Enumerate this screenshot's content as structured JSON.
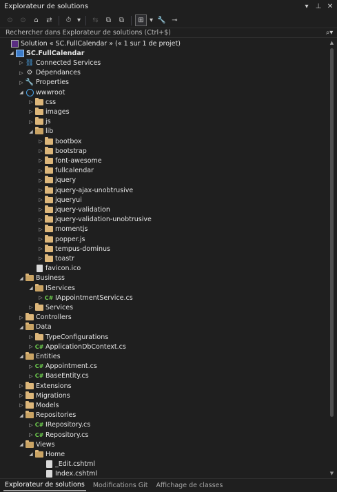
{
  "window": {
    "title": "Explorateur de solutions",
    "controls": [
      "▾",
      "⊥",
      "✕"
    ]
  },
  "toolbar": {
    "items": [
      {
        "icon": "back-arrow-icon",
        "glyph": "⊙",
        "enabled": false
      },
      {
        "icon": "forward-arrow-icon",
        "glyph": "⊙",
        "enabled": false
      },
      {
        "icon": "home-icon",
        "glyph": "⌂",
        "enabled": true
      },
      {
        "icon": "switch-views-icon",
        "glyph": "⇄",
        "enabled": true
      },
      {
        "icon": "pending-changes-filter-icon",
        "glyph": "⏱",
        "enabled": true
      },
      {
        "icon": "dropdown-icon",
        "glyph": "▾",
        "enabled": true
      },
      {
        "icon": "sync-icon",
        "glyph": "⇆",
        "enabled": false
      },
      {
        "icon": "collapse-all-icon",
        "glyph": "⧉",
        "enabled": true
      },
      {
        "icon": "show-all-files-icon",
        "glyph": "⧉",
        "enabled": true
      },
      {
        "icon": "tree-view-icon",
        "glyph": "⊞",
        "enabled": true,
        "active": true
      },
      {
        "icon": "dropdown-icon",
        "glyph": "▾",
        "enabled": true
      },
      {
        "icon": "properties-wrench-icon",
        "glyph": "🔧",
        "enabled": true
      },
      {
        "icon": "preview-icon",
        "glyph": "⊸",
        "enabled": true
      }
    ]
  },
  "search": {
    "placeholder": "Rechercher dans Explorateur de solutions (Ctrl+$)",
    "icon": "search-icon"
  },
  "tree": [
    {
      "level": 0,
      "arrow": "",
      "icon": "sol",
      "label": "Solution « SC.FullCalendar » (« 1 sur 1 de projet)"
    },
    {
      "level": 0,
      "arrow": "open",
      "icon": "proj",
      "label": "SC.FullCalendar",
      "bold": true
    },
    {
      "level": 1,
      "arrow": "closed",
      "icon": "conn",
      "label": "Connected Services"
    },
    {
      "level": 1,
      "arrow": "closed",
      "icon": "deps",
      "label": "Dépendances"
    },
    {
      "level": 1,
      "arrow": "closed",
      "icon": "props",
      "label": "Properties"
    },
    {
      "level": 1,
      "arrow": "open",
      "icon": "globe",
      "label": "wwwroot"
    },
    {
      "level": 2,
      "arrow": "closed",
      "icon": "folder",
      "label": "css"
    },
    {
      "level": 2,
      "arrow": "closed",
      "icon": "folder",
      "label": "images"
    },
    {
      "level": 2,
      "arrow": "closed",
      "icon": "folder",
      "label": "js"
    },
    {
      "level": 2,
      "arrow": "open",
      "icon": "folder-open",
      "label": "lib"
    },
    {
      "level": 3,
      "arrow": "closed",
      "icon": "folder",
      "label": "bootbox"
    },
    {
      "level": 3,
      "arrow": "closed",
      "icon": "folder",
      "label": "bootstrap"
    },
    {
      "level": 3,
      "arrow": "closed",
      "icon": "folder",
      "label": "font-awesome"
    },
    {
      "level": 3,
      "arrow": "closed",
      "icon": "folder",
      "label": "fullcalendar"
    },
    {
      "level": 3,
      "arrow": "closed",
      "icon": "folder",
      "label": "jquery"
    },
    {
      "level": 3,
      "arrow": "closed",
      "icon": "folder",
      "label": "jquery-ajax-unobtrusive"
    },
    {
      "level": 3,
      "arrow": "closed",
      "icon": "folder",
      "label": "jqueryui"
    },
    {
      "level": 3,
      "arrow": "closed",
      "icon": "folder",
      "label": "jquery-validation"
    },
    {
      "level": 3,
      "arrow": "closed",
      "icon": "folder",
      "label": "jquery-validation-unobtrusive"
    },
    {
      "level": 3,
      "arrow": "closed",
      "icon": "folder",
      "label": "momentjs"
    },
    {
      "level": 3,
      "arrow": "closed",
      "icon": "folder",
      "label": "popper.js"
    },
    {
      "level": 3,
      "arrow": "closed",
      "icon": "folder",
      "label": "tempus-dominus"
    },
    {
      "level": 3,
      "arrow": "closed",
      "icon": "folder",
      "label": "toastr"
    },
    {
      "level": 2,
      "arrow": "",
      "icon": "file",
      "label": "favicon.ico"
    },
    {
      "level": 1,
      "arrow": "open",
      "icon": "folder-open",
      "label": "Business"
    },
    {
      "level": 2,
      "arrow": "open",
      "icon": "folder-open",
      "label": "IServices"
    },
    {
      "level": 3,
      "arrow": "closed",
      "icon": "cs",
      "label": "IAppointmentService.cs"
    },
    {
      "level": 2,
      "arrow": "closed",
      "icon": "folder",
      "label": "Services"
    },
    {
      "level": 1,
      "arrow": "closed",
      "icon": "folder",
      "label": "Controllers"
    },
    {
      "level": 1,
      "arrow": "open",
      "icon": "folder-open",
      "label": "Data"
    },
    {
      "level": 2,
      "arrow": "closed",
      "icon": "folder",
      "label": "TypeConfigurations"
    },
    {
      "level": 2,
      "arrow": "closed",
      "icon": "cs",
      "label": "ApplicationDbContext.cs"
    },
    {
      "level": 1,
      "arrow": "open",
      "icon": "folder-open",
      "label": "Entities"
    },
    {
      "level": 2,
      "arrow": "closed",
      "icon": "cs",
      "label": "Appointment.cs"
    },
    {
      "level": 2,
      "arrow": "closed",
      "icon": "cs",
      "label": "BaseEntity.cs"
    },
    {
      "level": 1,
      "arrow": "closed",
      "icon": "folder",
      "label": "Extensions"
    },
    {
      "level": 1,
      "arrow": "closed",
      "icon": "folder",
      "label": "Migrations"
    },
    {
      "level": 1,
      "arrow": "closed",
      "icon": "folder",
      "label": "Models"
    },
    {
      "level": 1,
      "arrow": "open",
      "icon": "folder-open",
      "label": "Repositories"
    },
    {
      "level": 2,
      "arrow": "closed",
      "icon": "cs",
      "label": "IRepository.cs"
    },
    {
      "level": 2,
      "arrow": "closed",
      "icon": "cs",
      "label": "Repository.cs"
    },
    {
      "level": 1,
      "arrow": "open",
      "icon": "folder-open",
      "label": "Views"
    },
    {
      "level": 2,
      "arrow": "open",
      "icon": "folder-open",
      "label": "Home"
    },
    {
      "level": 3,
      "arrow": "",
      "icon": "file",
      "label": "_Edit.cshtml"
    },
    {
      "level": 3,
      "arrow": "",
      "icon": "file",
      "label": "Index.cshtml"
    }
  ],
  "tabs": [
    {
      "label": "Explorateur de solutions",
      "active": true
    },
    {
      "label": "Modifications Git",
      "active": false
    },
    {
      "label": "Affichage de classes",
      "active": false
    }
  ],
  "colors": {
    "background": "#1f1f1f",
    "folder": "#dcb67a",
    "csharp": "#6fcf4f",
    "accent_blue": "#4aa3e8"
  }
}
